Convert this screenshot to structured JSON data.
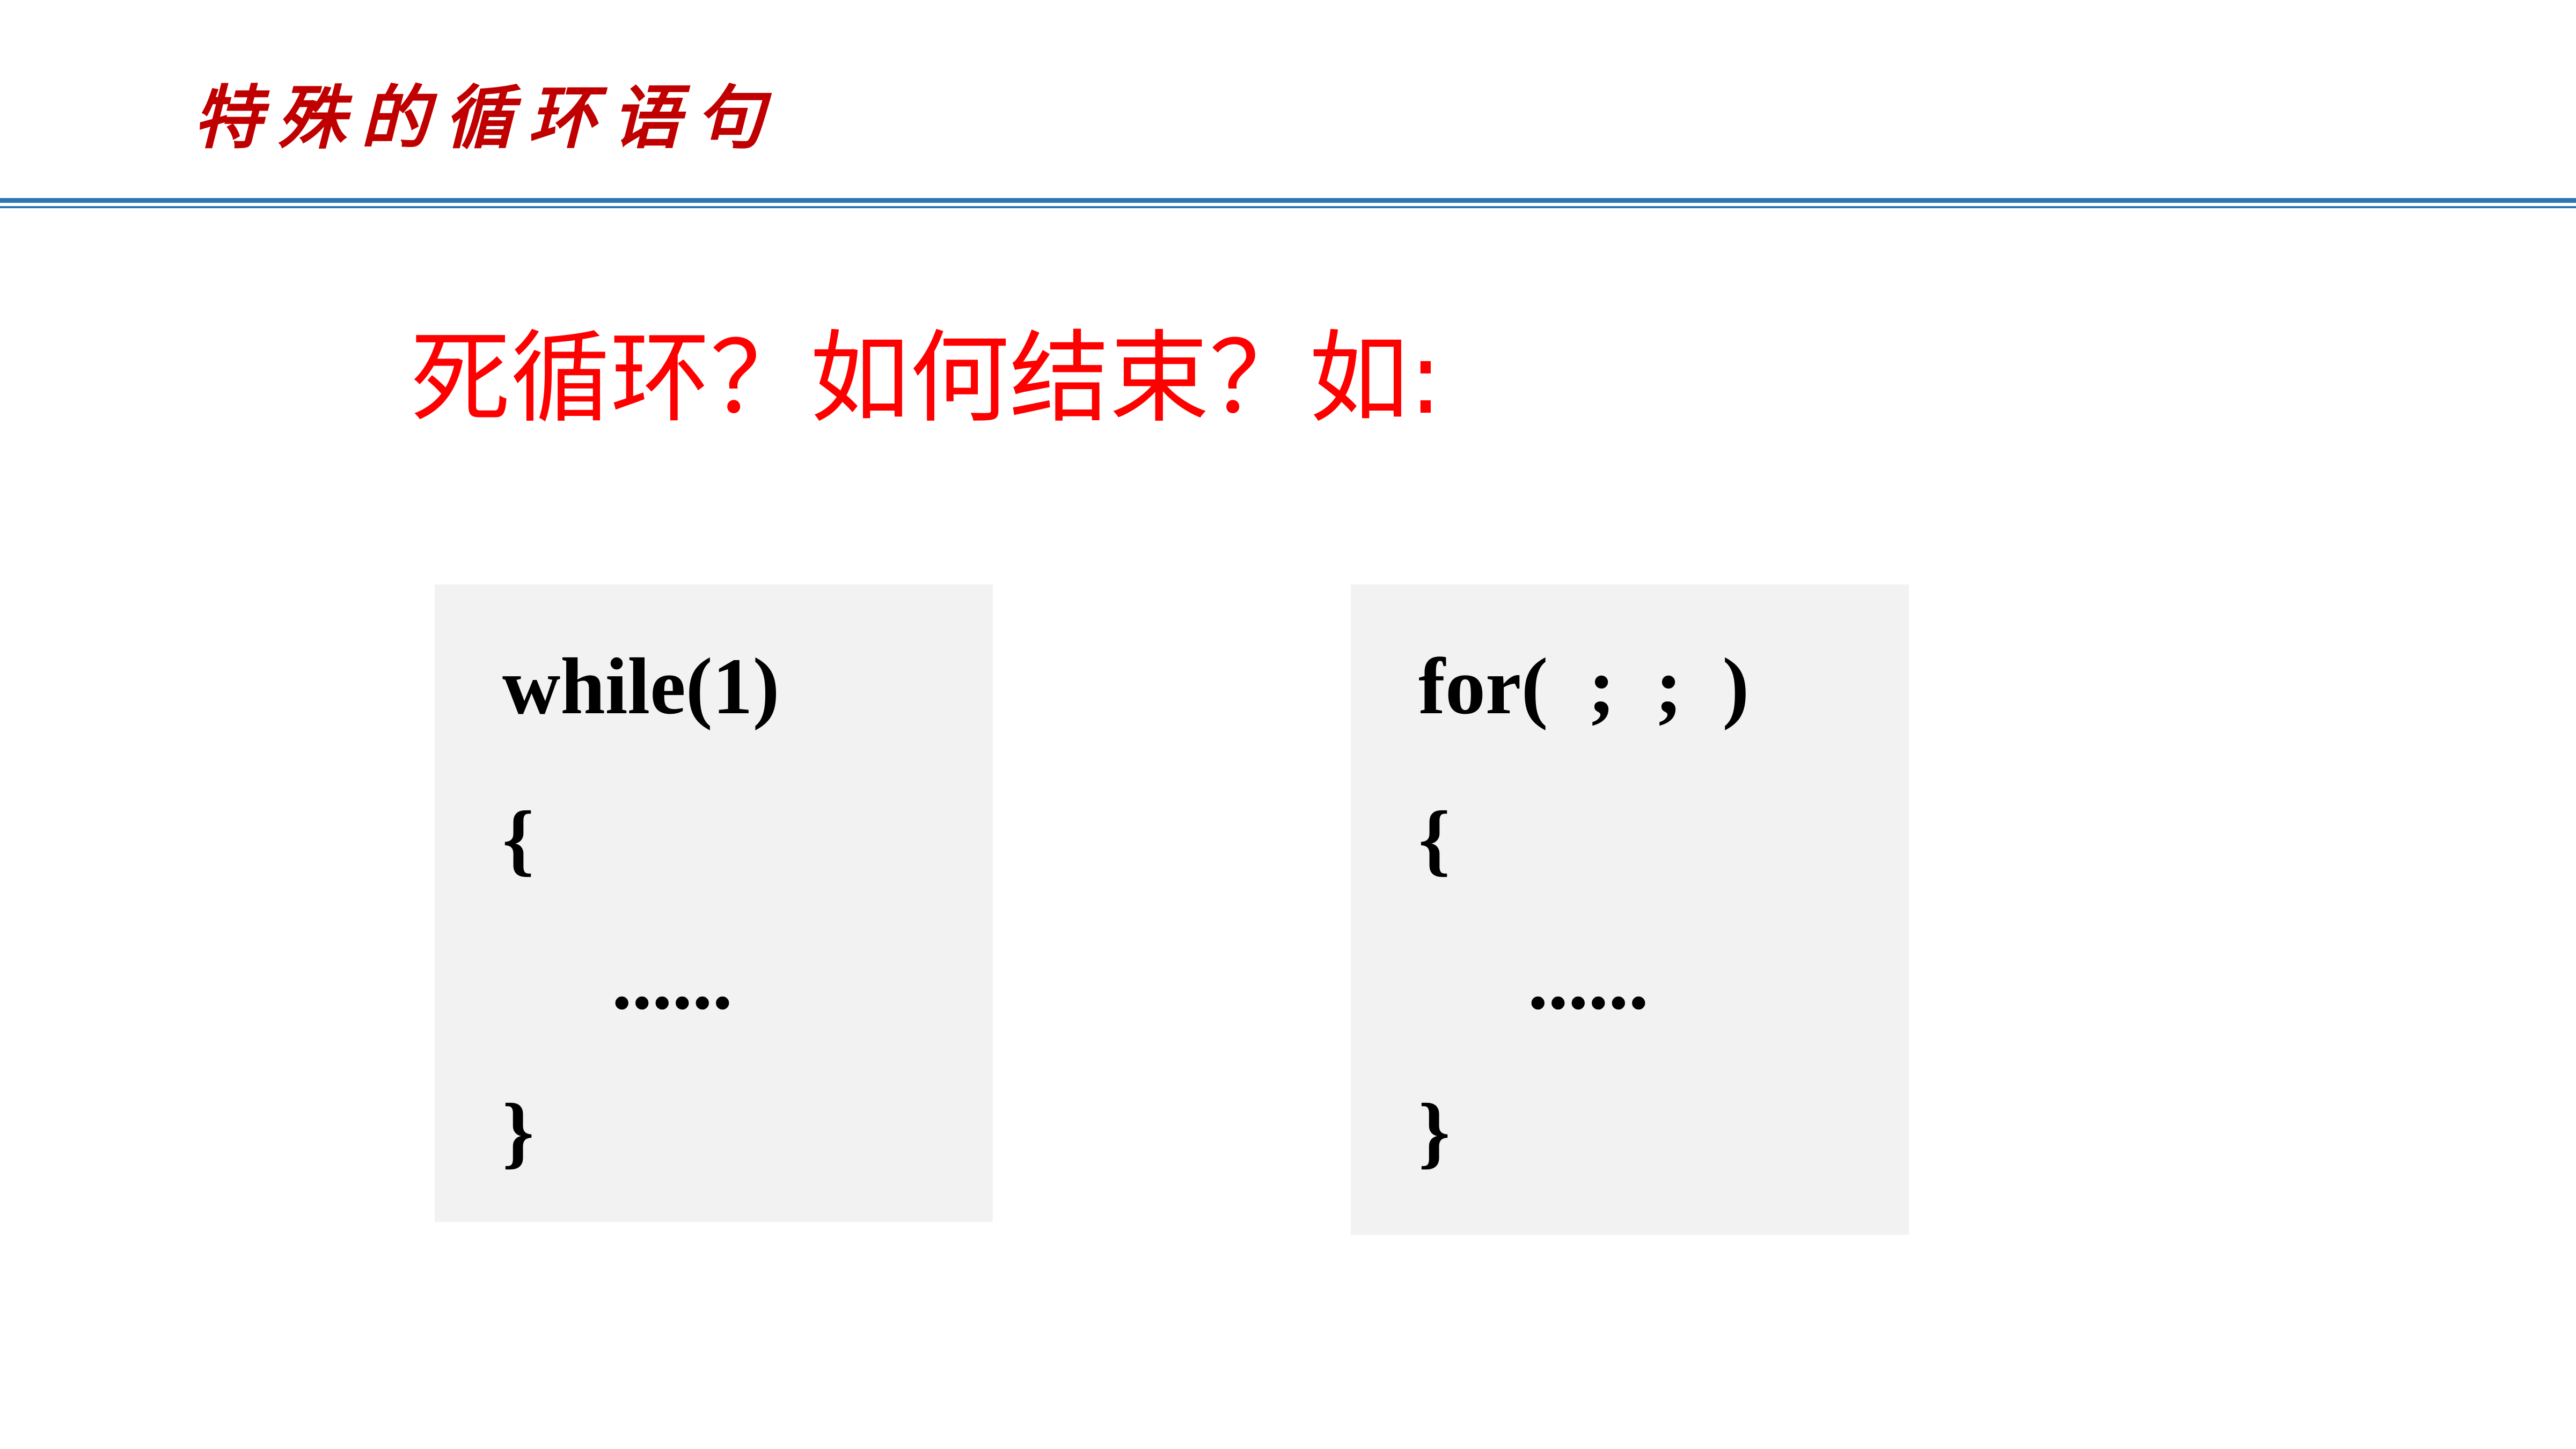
{
  "slide": {
    "title": "特殊的循环语句",
    "question": "死循环？如何结束？如:"
  },
  "code_blocks": {
    "while_block": {
      "header": "while(1)",
      "open_brace": "{",
      "body": "......",
      "close_brace": "}"
    },
    "for_block": {
      "header": "for(  ;  ;  )",
      "open_brace": "{",
      "body": "......",
      "close_brace": "}"
    }
  },
  "colors": {
    "title": "#c00000",
    "question": "#ff0000",
    "rule": "#2e75b6",
    "code_box_bg": "#f2f2f2",
    "code_text": "#000000"
  }
}
